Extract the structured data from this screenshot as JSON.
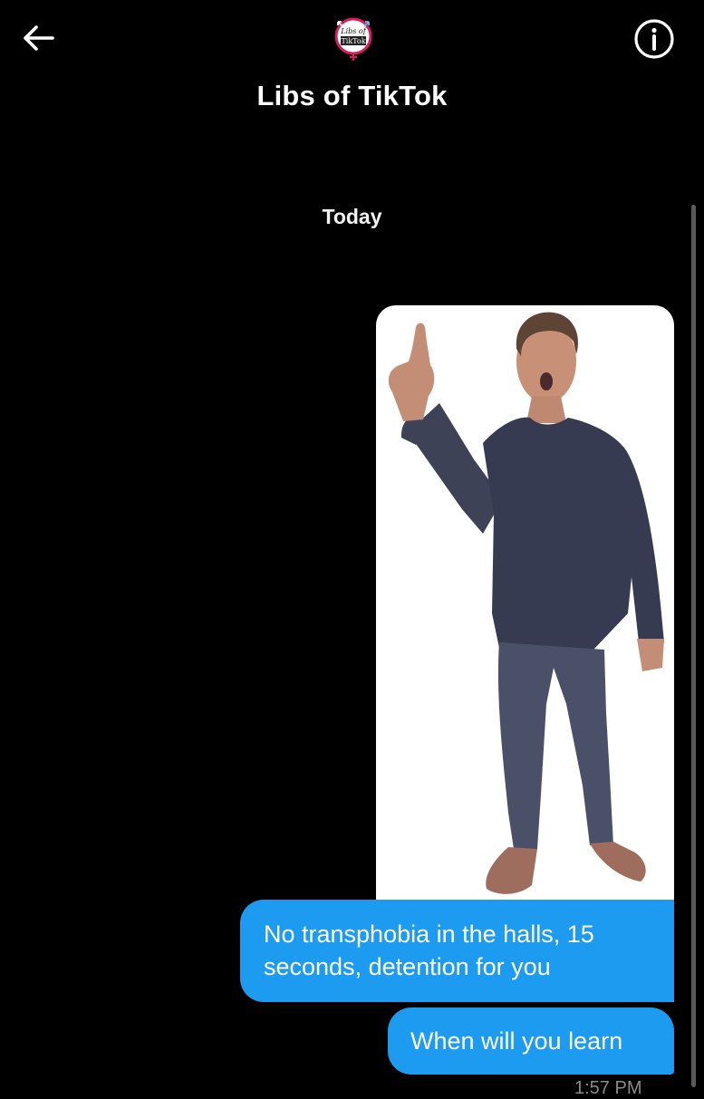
{
  "header": {
    "title": "Libs of TikTok",
    "back_icon": "arrow-left-icon",
    "info_icon": "info-circle-icon",
    "avatar_text": [
      "Libs of",
      "TikTok"
    ]
  },
  "conversation": {
    "date_separator": "Today",
    "messages": [
      {
        "type": "image",
        "description": "person-pointing-up"
      },
      {
        "type": "text",
        "lines": [
          "No transphobia in the halls, 15",
          "seconds, detention for you"
        ]
      },
      {
        "type": "text",
        "text": "When will you learn"
      }
    ],
    "timestamp": "1:57 PM"
  },
  "colors": {
    "background": "#000000",
    "bubble": "#1d9bf0",
    "text": "#ffffff",
    "muted": "#8b8b8b"
  }
}
